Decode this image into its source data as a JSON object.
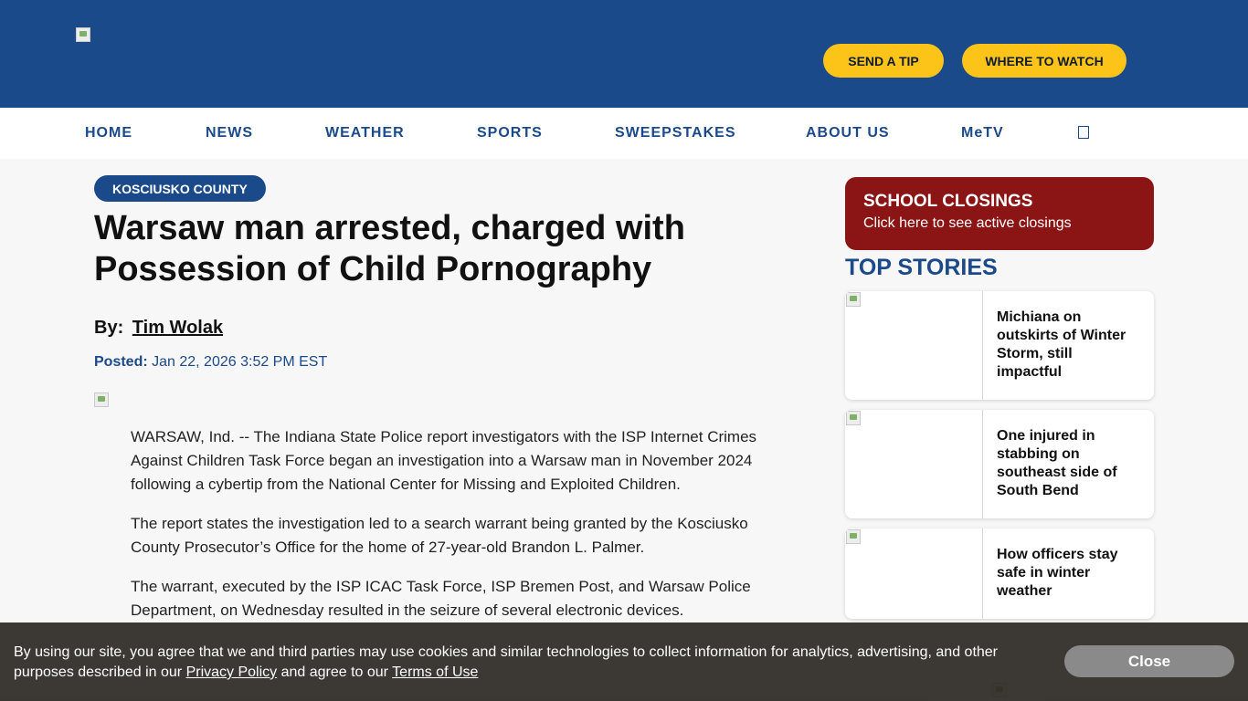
{
  "header": {
    "logo_icon": "broken-image-icon",
    "send_tip": "SEND A TIP",
    "where_to_watch": "WHERE TO WATCH"
  },
  "nav": {
    "items": [
      "HOME",
      "NEWS",
      "WEATHER",
      "SPORTS",
      "SWEEPSTAKES",
      "ABOUT US",
      "MeTV"
    ],
    "search_icon": "search-icon"
  },
  "article": {
    "category": "KOSCIUSKO COUNTY",
    "headline": "Warsaw man arrested, charged with Possession of Child Pornography",
    "by_label": "By:",
    "author": "Tim Wolak",
    "posted_label": "Posted:",
    "posted_date": "Jan 22, 2026 3:52 PM EST",
    "paragraphs": [
      "WARSAW, Ind. -- The Indiana State Police report investigators with the ISP Internet Crimes Against Children Task Force began an investigation into a Warsaw man in November 2024 following a cybertip from the National Center for Missing and Exploited Children.",
      "The report states the investigation led to a search warrant being granted by the Kosciusko County Prosecutor’s Office for the home of 27-year-old Brandon L. Palmer.",
      "The warrant, executed by the ISP ICAC Task Force, ISP Bremen Post, and Warsaw Police Department, on Wednesday resulted in the seizure of several electronic devices."
    ]
  },
  "sidebar": {
    "closings_title": "SCHOOL CLOSINGS",
    "closings_sub": "Click here to see active closings",
    "top_stories_heading": "TOP STORIES",
    "stories": [
      {
        "title": "Michiana on outskirts of Winter Storm, still impactful"
      },
      {
        "title": "One injured in stabbing on southeast side of South Bend"
      },
      {
        "title": "How officers stay safe in winter weather"
      }
    ]
  },
  "cookie": {
    "text_before": "By using our site, you agree that we and third parties may use cookies and similar technologies to collect information for analytics, advertising, and other purposes described in our ",
    "privacy_link": "Privacy Policy",
    "text_middle": " and agree to our ",
    "terms_link": "Terms of Use",
    "close_label": "Close"
  },
  "colors": {
    "brand_blue": "#1b4a8a",
    "accent_yellow": "#fcc419",
    "closings_red": "#8b1414"
  }
}
